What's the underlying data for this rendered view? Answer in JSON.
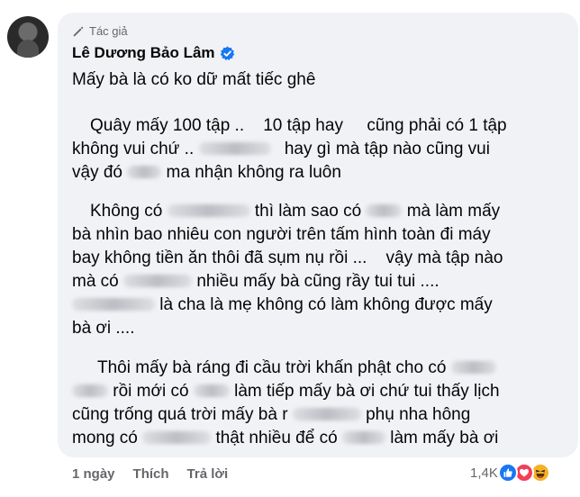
{
  "comment": {
    "author_tag": "Tác giả",
    "author_name": "Lê Dương Bảo Lâm",
    "lines": {
      "l1": "Mấy bà là có ko dữ mất tiếc ghê",
      "l2": "Quây mấy 100 tập ..    10 tập hay     cũng phải có 1 tập",
      "l3a": "không vui chứ ..",
      "l3b": "hay gì mà tập nào cũng vui",
      "l4a": "vậy đó",
      "l4b": "ma nhận không ra luôn",
      "l5a": "Không có",
      "l5b": "thì làm sao có",
      "l5c": "mà làm mấy",
      "l6": "bà nhìn bao nhiêu con người trên tấm hình toàn đi máy",
      "l7": "bay không tiền ăn thôi đã sụm nụ rồi ...    vậy mà tập nào",
      "l8a": "mà có",
      "l8b": "nhiều mấy bà cũng rầy tui tui ....",
      "l9": "là cha là mẹ không có làm không được mấy",
      "l10": "bà ơi ....",
      "l11a": "Thôi mấy bà ráng đi cầu trời khấn phật cho có",
      "l12a": "rồi mới có",
      "l12b": "làm tiếp mấy bà ơi chứ tui thấy lịch",
      "l13a": "cũng trống quá trời mấy bà r",
      "l13b": "phụ nha hông",
      "l14a": "mong có",
      "l14b": "thật nhiều để có",
      "l14c": "làm mấy bà ơi"
    }
  },
  "actions": {
    "time": "1 ngày",
    "like": "Thích",
    "reply": "Trả lời"
  },
  "reactions": {
    "count": "1,4K",
    "types": [
      "like-icon",
      "love-icon",
      "haha-icon"
    ]
  },
  "colors": {
    "bubble": "#f0f2f5",
    "secondary_text": "#65676b",
    "verified_blue": "#1877f2",
    "love_red": "#f33e58",
    "haha_yellow": "#f7b125"
  }
}
